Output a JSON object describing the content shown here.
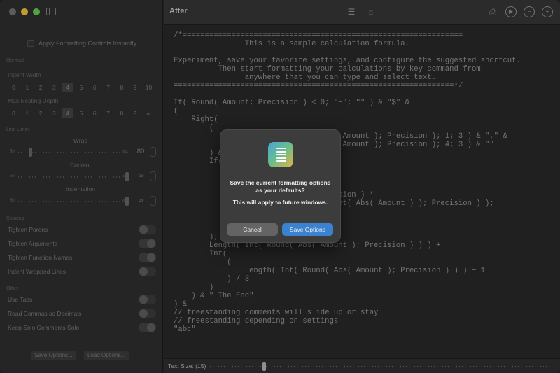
{
  "window": {
    "title": "After",
    "traffic_colors": {
      "close": "#6b6b6b",
      "minimize": "#e8b53b",
      "maximize": "#5ec04a"
    }
  },
  "sidebar": {
    "apply_instantly_label": "Apply Formatting Controls Instantly",
    "general": {
      "heading": "General",
      "indent_width_label": "Indent Width",
      "indent_width_options": [
        "0",
        "1",
        "2",
        "3",
        "4",
        "5",
        "6",
        "7",
        "8",
        "9",
        "10"
      ],
      "indent_width_selected": "4",
      "max_nesting_label": "Max Nesting Depth",
      "max_nesting_options": [
        "0",
        "1",
        "2",
        "3",
        "4",
        "5",
        "6",
        "7",
        "8",
        "9",
        "∞"
      ],
      "max_nesting_selected": "4"
    },
    "line_limits": {
      "heading": "Line Limits",
      "wrap": {
        "label": "Wrap",
        "min": "50",
        "inf": "∞",
        "value": "80",
        "level": 0.1
      },
      "content": {
        "label": "Content",
        "min": "50",
        "inf": "∞",
        "value": "∞",
        "level": 1.0
      },
      "indentation": {
        "label": "Indentation",
        "min": "50",
        "inf": "∞",
        "value": "∞",
        "level": 1.0
      }
    },
    "spacing": {
      "heading": "Spacing",
      "items": [
        {
          "label": "Tighten Parens",
          "on": false
        },
        {
          "label": "Tighten Arguments",
          "on": true
        },
        {
          "label": "Tighten Function Names",
          "on": true
        },
        {
          "label": "Indent Wrapped Lines",
          "on": false
        }
      ]
    },
    "other": {
      "heading": "Other",
      "items": [
        {
          "label": "Use Tabs",
          "on": false
        },
        {
          "label": "Read Commas as Decimals",
          "on": false
        },
        {
          "label": "Keep Solo Comments Solo",
          "on": true
        }
      ]
    },
    "save_options_label": "Save Options...",
    "load_options_label": "Load Options..."
  },
  "toolbar": {
    "icons": [
      "list-icon",
      "lightbulb-icon",
      "document-icon",
      "play-icon",
      "zoom-out-icon",
      "zoom-in-icon"
    ]
  },
  "editor": {
    "code": "/*===============================================================\n                This is a sample calculation formula.\n\nExperiment, save your favorite settings, and configure the suggested shortcut.\n          Then start formatting your calculations by key command from\n                anywhere that you can type and select text.\n===============================================================*/\n\nIf( Round( Amount; Precision ) < 0; \"−\"; \"\" ) & \"$\" &\n(\n    Right(\n        (\n                                  bs( Amount ); Precision ); 1; 3 ) & \",\" &\n                                  bs( Amount ); Precision ); 4; 3 ) & \"\"\n        ) &\n        If(\n\n\n\n                                  ecision ) *\n                                  − Int( Abs( Amount ) ); Precision ) );\n\n\n\n        );\n        Length( Int( Round( Abs( Amount ); Precision ) ) ) +\n        Int(\n            (\n                Length( Int( Round( Abs( Amount ); Precision ) ) ) − 1\n            ) / 3\n        )\n    ) & \" The End\"\n) &\n// freestanding comments will slide up or stay\n// freestanding depending on settings\n\"abc\""
  },
  "status": {
    "text_size_label": "Text Size: (15)",
    "text_size_level": 0.15
  },
  "dialog": {
    "message": "Save the current formatting options as your defaults?",
    "info": "This will apply to future windows.",
    "cancel_label": "Cancel",
    "confirm_label": "Save Options",
    "accent": "#3b82d0"
  }
}
